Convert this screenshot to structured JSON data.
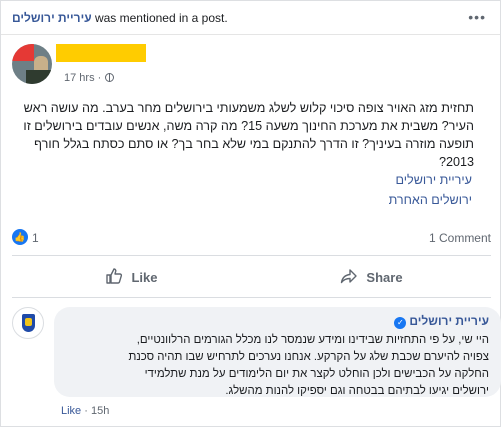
{
  "mention": {
    "page_name": "עיריית ירושלים",
    "text": " was mentioned in a post.",
    "menu_icon": "more-dots-icon"
  },
  "post": {
    "time": "17 hrs",
    "privacy_icon": "globe-icon",
    "text_lines": [
      "תחזית מזג האויר צופה סיכוי קלוש לשלג משמעותי בירושלים מחר בערב. מה עושה ראש",
      "העיר? משבית את מערכת החינוך משעה 15? מה קרה משה, אנשים עובדים בירושלים זו",
      "תופעה מוזרה בעיניך? זו הדרך להתנקם במי שלא בחר בך? או סתם כסתח בגלל חורף",
      "2013?"
    ],
    "hashtags": [
      "עיריית ירושלים",
      "ירושלים האחרת"
    ]
  },
  "stats": {
    "like_count": "1",
    "comment_count": "1 Comment"
  },
  "actions": {
    "like_label": "Like",
    "share_label": "Share"
  },
  "comment": {
    "author": "עיריית ירושלים",
    "text_lines": [
      "היי שי, על פי התחזיות שבידינו ומידע שנמסר לנו מכלל הגורמים הרלוונטיים,",
      "צפויה להיערם שכבת שלג על הקרקע. אנחנו נערכים לתרחיש שבו תהיה סכנת",
      "החלקה על הכבישים ולכן הוחלט לקצר את יום הלימודים על מנת שתלמידי",
      "ירושלים יגיעו לבתיהם בבטחה וגם יספיקו להנות מהשלג."
    ],
    "like_label": "Like",
    "separator": "·",
    "time": "15h"
  },
  "colors": {
    "link": "#385898",
    "like_blue": "#1877f2",
    "redaction": "#ffcc00"
  }
}
